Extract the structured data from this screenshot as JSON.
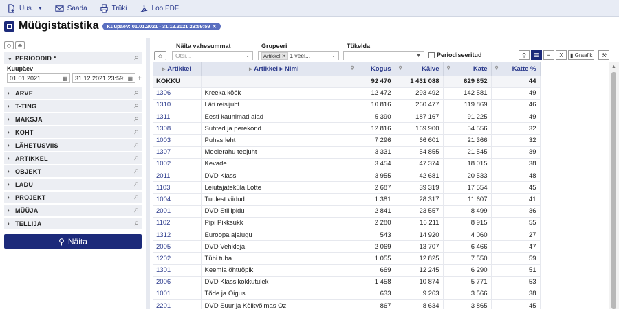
{
  "toolbar": {
    "new_label": "Uus",
    "send_label": "Saada",
    "print_label": "Trüki",
    "pdf_label": "Loo PDF"
  },
  "title": "Müügistatistika",
  "chip": "Kuupäev: 01.01.2021 - 31.12.2021 23:59:59",
  "left": {
    "groups_top": "PERIOODID *",
    "kuupaev_label": "Kuupäev",
    "date_from": "01.01.2021",
    "date_to": "31.12.2021 23:59:",
    "groups": [
      "ARVE",
      "T-TING",
      "MAKSJA",
      "KOHT",
      "LÄHETUSVIIS",
      "ARTIKKEL",
      "OBJEKT",
      "LADU",
      "PROJEKT",
      "MÜÜJA",
      "TELLIJA"
    ],
    "show_label": "Näita"
  },
  "filters": {
    "subtotals_label": "Näita vahesummat",
    "subtotals_placeholder": "Otsi...",
    "group_label": "Grupeeri",
    "group_tag": "Artikkel",
    "group_more": "1 veel...",
    "split_label": "Tükelda",
    "periodic_label": "Periodiseeritud",
    "graph_label": "Graafik"
  },
  "table": {
    "headers": [
      "Artikkel",
      "Artikkel ▸ Nimi",
      "Kogus",
      "Käive",
      "Kate",
      "Katte %"
    ],
    "total": [
      "KOKKU",
      "",
      "92 470",
      "1 431 088",
      "629 852",
      "44"
    ],
    "rows": [
      [
        "1306",
        "Kreeka köök",
        "12 472",
        "293 492",
        "142 581",
        "49"
      ],
      [
        "1310",
        "Läti reisijuht",
        "10 816",
        "260 477",
        "119 869",
        "46"
      ],
      [
        "1311",
        "Eesti kaunimad aiad",
        "5 390",
        "187 167",
        "91 225",
        "49"
      ],
      [
        "1308",
        "Suhted ja perekond",
        "12 816",
        "169 900",
        "54 556",
        "32"
      ],
      [
        "1003",
        "Puhas leht",
        "7 296",
        "66 601",
        "21 366",
        "32"
      ],
      [
        "1307",
        "Meelerahu teejuht",
        "3 331",
        "54 855",
        "21 545",
        "39"
      ],
      [
        "1002",
        "Kevade",
        "3 454",
        "47 374",
        "18 015",
        "38"
      ],
      [
        "2011",
        "DVD Klass",
        "3 955",
        "42 681",
        "20 533",
        "48"
      ],
      [
        "1103",
        "Leiutajateküla Lotte",
        "2 687",
        "39 319",
        "17 554",
        "45"
      ],
      [
        "1004",
        "Tuulest viidud",
        "1 381",
        "28 317",
        "11 607",
        "41"
      ],
      [
        "2001",
        "DVD Stiilipidu",
        "2 841",
        "23 557",
        "8 499",
        "36"
      ],
      [
        "1102",
        "Pipi Pikksukk",
        "2 280",
        "16 211",
        "8 915",
        "55"
      ],
      [
        "1312",
        "Euroopa ajalugu",
        "543",
        "14 920",
        "4 060",
        "27"
      ],
      [
        "2005",
        "DVD Vehkleja",
        "2 069",
        "13 707",
        "6 466",
        "47"
      ],
      [
        "1202",
        "Tühi tuba",
        "1 055",
        "12 825",
        "7 550",
        "59"
      ],
      [
        "1301",
        "Keemia õhtuõpik",
        "669",
        "12 245",
        "6 290",
        "51"
      ],
      [
        "2006",
        "DVD Klassikokkutulek",
        "1 458",
        "10 874",
        "5 771",
        "53"
      ],
      [
        "1001",
        "Tõde ja Õigus",
        "633",
        "9 263",
        "3 566",
        "38"
      ],
      [
        "2201",
        "DVD Suur ja Kõikvõimas Oz",
        "867",
        "8 634",
        "3 865",
        "45"
      ]
    ]
  }
}
